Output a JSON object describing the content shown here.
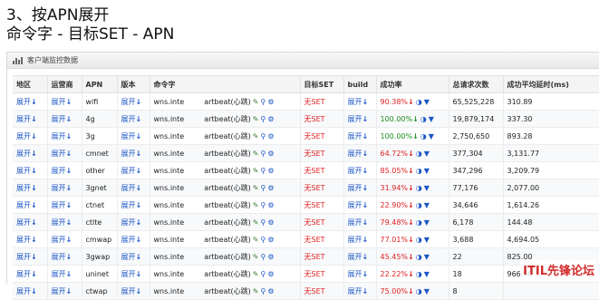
{
  "title_line1": "3、按APN展开",
  "title_line2": "命令字 - 目标SET - APN",
  "panel": {
    "title": "客户端监控数据"
  },
  "headers": [
    "地区",
    "运营商",
    "APN",
    "版本",
    "命令字",
    "目标SET",
    "build",
    "成功率",
    "总请求次数",
    "成功平均延时(ms)"
  ],
  "expand_label": "展开",
  "rows": [
    {
      "apn": "wifi",
      "cmd": "wns.inte",
      "cmd2": "artbeat(心跳)",
      "set": "无SET",
      "rate": "90.38%",
      "dir": "down",
      "color": "red",
      "total": "65,525,228",
      "avg": "310.89"
    },
    {
      "apn": "4g",
      "cmd": "wns.inte",
      "cmd2": "artbeat(心跳)",
      "set": "无SET",
      "rate": "100.00%",
      "dir": "down",
      "color": "green",
      "total": "19,879,174",
      "avg": "337.30"
    },
    {
      "apn": "3g",
      "cmd": "wns.inte",
      "cmd2": "artbeat(心跳)",
      "set": "无SET",
      "rate": "100.00%",
      "dir": "down",
      "color": "green",
      "total": "2,750,650",
      "avg": "893.28"
    },
    {
      "apn": "cmnet",
      "cmd": "wns.inte",
      "cmd2": "artbeat(心跳)",
      "set": "无SET",
      "rate": "64.72%",
      "dir": "down",
      "color": "red",
      "total": "377,304",
      "avg": "3,131.77"
    },
    {
      "apn": "other",
      "cmd": "wns.inte",
      "cmd2": "artbeat(心跳)",
      "set": "无SET",
      "rate": "85.05%",
      "dir": "down",
      "color": "red",
      "total": "347,296",
      "avg": "3,209.79"
    },
    {
      "apn": "3gnet",
      "cmd": "wns.inte",
      "cmd2": "artbeat(心跳)",
      "set": "无SET",
      "rate": "31.94%",
      "dir": "down",
      "color": "red",
      "total": "77,176",
      "avg": "2,077.00"
    },
    {
      "apn": "ctnet",
      "cmd": "wns.inte",
      "cmd2": "artbeat(心跳)",
      "set": "无SET",
      "rate": "22.90%",
      "dir": "down",
      "color": "red",
      "total": "34,646",
      "avg": "1,614.26"
    },
    {
      "apn": "ctlte",
      "cmd": "wns.inte",
      "cmd2": "artbeat(心跳)",
      "set": "无SET",
      "rate": "79.48%",
      "dir": "down",
      "color": "red",
      "total": "6,178",
      "avg": "144.48"
    },
    {
      "apn": "cmwap",
      "cmd": "wns.inte",
      "cmd2": "artbeat(心跳)",
      "set": "无SET",
      "rate": "77.01%",
      "dir": "down",
      "color": "red",
      "total": "3,688",
      "avg": "4,694.05"
    },
    {
      "apn": "3gwap",
      "cmd": "wns.inte",
      "cmd2": "artbeat(心跳)",
      "set": "无SET",
      "rate": "45.45%",
      "dir": "down",
      "color": "red",
      "total": "22",
      "avg": "825.00"
    },
    {
      "apn": "uninet",
      "cmd": "wns.inte",
      "cmd2": "artbeat(心跳)",
      "set": "无SET",
      "rate": "22.22%",
      "dir": "down",
      "color": "red",
      "total": "18",
      "avg": "966.50"
    },
    {
      "apn": "ctwap",
      "cmd": "wns.inte",
      "cmd2": "artbeat(心跳)",
      "set": "无SET",
      "rate": "75.00%",
      "dir": "down",
      "color": "red",
      "total": "8",
      "avg": ""
    }
  ],
  "watermark": "ITIL先锋论坛"
}
